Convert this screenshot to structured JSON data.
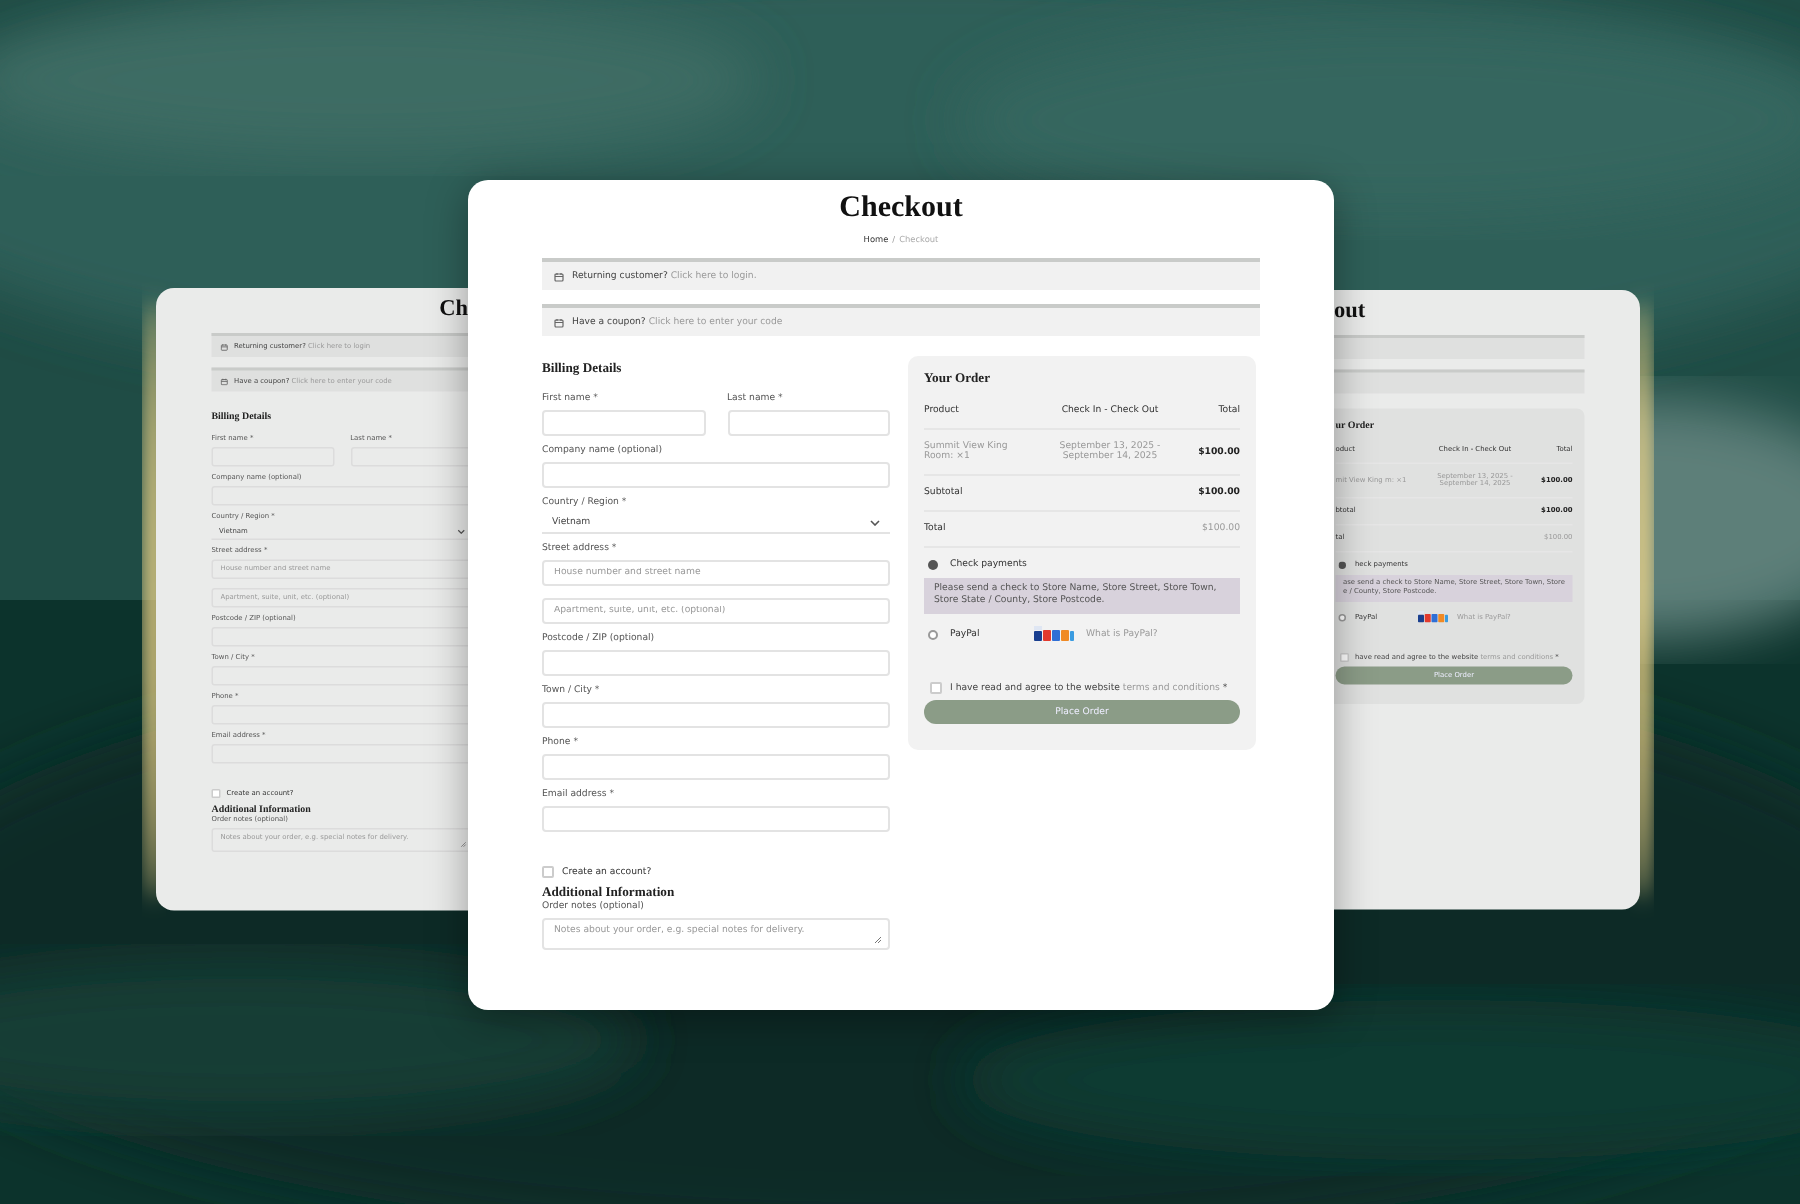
{
  "cards": [
    {
      "kind": "left",
      "title": "Ch",
      "notices": [
        {
          "text": "Returning customer?",
          "link": "Click here to login"
        },
        {
          "text": "Have a coupon?",
          "link": "Click here to enter your code"
        }
      ],
      "billing": {
        "heading": "Billing Details",
        "name_fields": [
          {
            "label": "First name *"
          },
          {
            "label": "Last name *"
          }
        ],
        "fields": [
          {
            "kind": "text",
            "label": "Company name (optional)"
          },
          {
            "kind": "select",
            "label": "Country / Region *",
            "value": "Vietnam"
          },
          {
            "kind": "text",
            "label": "Street address *",
            "placeholder": "House number and street name"
          },
          {
            "kind": "text",
            "placeholder": "Apartment, suite, unit, etc. (optional)"
          },
          {
            "kind": "text",
            "label": "Postcode / ZIP (optional)"
          },
          {
            "kind": "text",
            "label": "Town / City *"
          },
          {
            "kind": "text",
            "label": "Phone *"
          },
          {
            "kind": "text",
            "label": "Email address *"
          }
        ],
        "create_account": {
          "label": "Create an account?",
          "checked": false
        },
        "additional": {
          "heading": "Additional Information",
          "label": "Order notes (optional)",
          "placeholder": "Notes about your order, e.g. special notes for delivery."
        }
      }
    },
    {
      "kind": "center",
      "title": "Checkout",
      "breadcrumb": {
        "items": [
          "Home",
          "Checkout"
        ],
        "separator": "/"
      },
      "notices": [
        {
          "text": "Returning customer?",
          "link": "Click here to login."
        },
        {
          "text": "Have a coupon?",
          "link": "Click here to enter your code"
        }
      ],
      "billing": {
        "heading": "Billing Details",
        "name_fields": [
          {
            "label": "First name *"
          },
          {
            "label": "Last name *"
          }
        ],
        "fields": [
          {
            "kind": "text",
            "label": "Company name (optional)"
          },
          {
            "kind": "select",
            "label": "Country / Region *",
            "value": "Vietnam"
          },
          {
            "kind": "text",
            "label": "Street address *",
            "placeholder": "House number and street name"
          },
          {
            "kind": "text",
            "placeholder": "Apartment, suite, unit, etc. (optional)"
          },
          {
            "kind": "text",
            "label": "Postcode / ZIP (optional)"
          },
          {
            "kind": "text",
            "label": "Town / City *"
          },
          {
            "kind": "text",
            "label": "Phone *"
          },
          {
            "kind": "text",
            "label": "Email address *"
          }
        ],
        "create_account": {
          "label": "Create an account?",
          "checked": false
        },
        "additional": {
          "heading": "Additional Information",
          "label": "Order notes (optional)",
          "placeholder": "Notes about your order, e.g. special notes for delivery."
        }
      },
      "order": {
        "heading": "Your Order",
        "columns": [
          "Product",
          "Check In - Check Out",
          "Total"
        ],
        "items": [
          {
            "product": "Summit View King Room: ×1",
            "dates": "September 13, 2025 - September 14, 2025",
            "total": "$100.00"
          }
        ],
        "subtotal": {
          "label": "Subtotal",
          "value": "$100.00"
        },
        "total": {
          "label": "Total",
          "value": "$100.00"
        },
        "payments": [
          {
            "kind": "check",
            "label": "Check payments",
            "selected": true,
            "description": "Please send a check to Store Name, Store Street, Store Town, Store State / County, Store Postcode."
          },
          {
            "kind": "paypal",
            "label": "PayPal",
            "selected": false,
            "link": "What is PayPal?"
          }
        ],
        "terms": {
          "text": "I have read and agree to the website",
          "link": "terms and conditions",
          "mark": "*",
          "checked": false
        },
        "button": "Place Order"
      }
    },
    {
      "kind": "right",
      "title": "out",
      "notice_bars": true,
      "order": {
        "heading": "ur Order",
        "columns": [
          "oduct",
          "Check In - Check Out",
          "Total"
        ],
        "items": [
          {
            "product": "mit View King m: ×1",
            "dates": "September 13, 2025 - September 14, 2025",
            "total": "$100.00"
          }
        ],
        "subtotal": {
          "label": "btotal",
          "value": "$100.00"
        },
        "total": {
          "label": "tal",
          "value": "$100.00"
        },
        "payments": [
          {
            "kind": "check",
            "label": "heck payments",
            "selected": true,
            "description": "ase send a check to Store Name, Store Street, Store Town, Store e / County, Store Postcode."
          },
          {
            "kind": "paypal",
            "label": "PayPal",
            "selected": false,
            "link": "What is PayPal?"
          }
        ],
        "terms": {
          "text": "have read and agree to the website",
          "link": "terms and conditions",
          "mark": "*",
          "checked": false
        },
        "button": "Place Order"
      }
    }
  ]
}
